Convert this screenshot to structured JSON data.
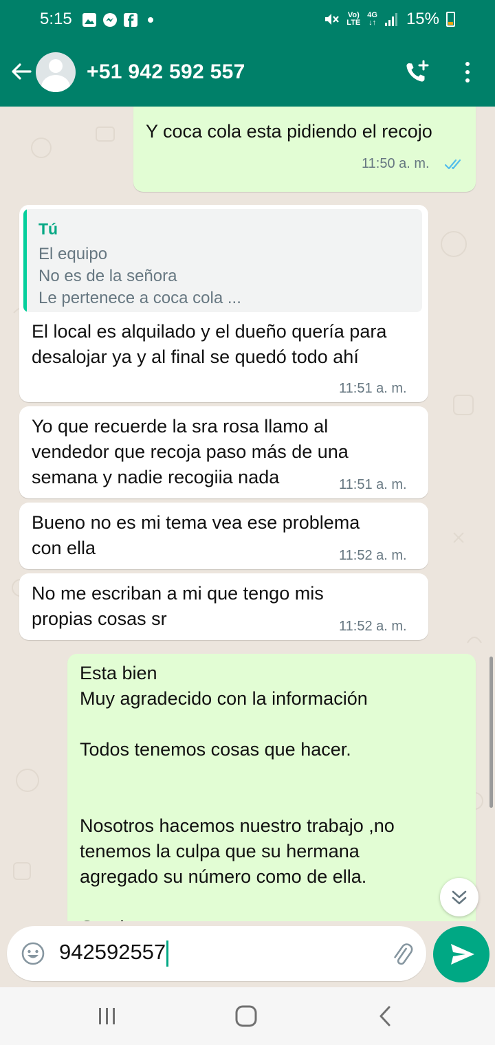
{
  "status_bar": {
    "time": "5:15",
    "battery": "15%",
    "network_small_top": "Vo)",
    "network_small_bottom": "LTE",
    "network_4g": "4G"
  },
  "header": {
    "contact_name": "+51 942 592 557",
    "icons": [
      "arrow-back-icon",
      "avatar",
      "add-call-icon",
      "more-vert-icon"
    ]
  },
  "messages": [
    {
      "direction": "out",
      "text": "Y coca cola esta pidiendo el recojo",
      "time": "11:50 a. m.",
      "read": true
    },
    {
      "direction": "in",
      "quote": {
        "author": "Tú",
        "text": "El equipo\nNo es de la señora\nLe pertenece a coca cola ..."
      },
      "text": "El local es alquilado y el dueño quería para\ndesalojar ya y al final se quedó todo ahí",
      "time": "11:51 a. m."
    },
    {
      "direction": "in",
      "text": "Yo que recuerde la sra rosa llamo al\nvendedor que recoja paso más de una\nsemana y nadie recogiia nada",
      "time": "11:51 a. m."
    },
    {
      "direction": "in",
      "text": "Bueno no es mi tema vea ese problema\ncon ella",
      "time": "11:52 a. m."
    },
    {
      "direction": "in",
      "text": "No me escriban a mi que tengo mis\npropias cosas sr",
      "time": "11:52 a. m."
    },
    {
      "direction": "out",
      "text": "Esta bien\nMuy agradecido con la información\n\nTodos tenemos cosas que hacer.\n\n\nNosotros hacemos nuestro trabajo ,no\ntenemos la culpa que su hermana\nagregado su número como de ella.\n\nGracias"
    }
  ],
  "composer": {
    "value": "942592557"
  },
  "colors": {
    "brand": "#008069",
    "outgoing_bubble": "#e2fdd4",
    "incoming_bubble": "#ffffff",
    "accent": "#00a884",
    "read_ticks": "#53bdeb"
  }
}
